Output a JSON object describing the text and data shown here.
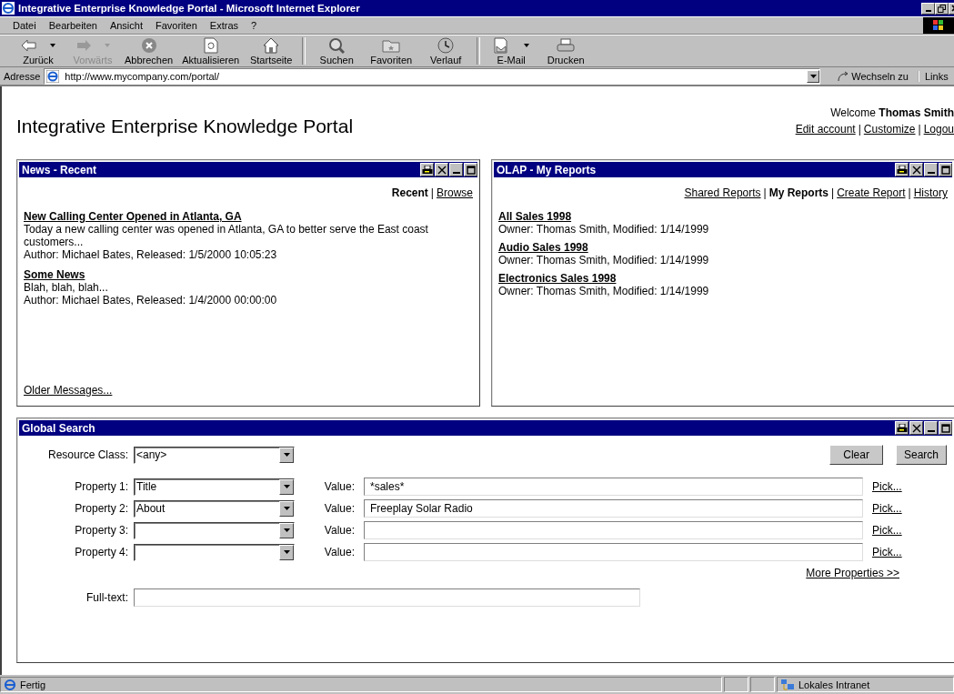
{
  "window": {
    "title": "Integrative Enterprise Knowledge Portal - Microsoft Internet Explorer"
  },
  "menu": [
    "Datei",
    "Bearbeiten",
    "Ansicht",
    "Favoriten",
    "Extras",
    "?"
  ],
  "toolbar": [
    [
      {
        "label": "Zurück",
        "disabled": false,
        "dropdown": true
      },
      {
        "label": "Vorwärts",
        "disabled": true,
        "dropdown": true
      },
      {
        "label": "Abbrechen",
        "disabled": false,
        "dropdown": false
      },
      {
        "label": "Aktualisieren",
        "disabled": false,
        "dropdown": false
      },
      {
        "label": "Startseite",
        "disabled": false,
        "dropdown": false
      }
    ],
    [
      {
        "label": "Suchen",
        "disabled": false,
        "dropdown": false
      },
      {
        "label": "Favoriten",
        "disabled": false,
        "dropdown": false
      },
      {
        "label": "Verlauf",
        "disabled": false,
        "dropdown": false
      }
    ],
    [
      {
        "label": "E-Mail",
        "disabled": false,
        "dropdown": true
      },
      {
        "label": "Drucken",
        "disabled": false,
        "dropdown": false
      }
    ]
  ],
  "address": {
    "label": "Adresse",
    "value": "http://www.mycompany.com/portal/",
    "go": "Wechseln zu",
    "links": "Links"
  },
  "portal": {
    "title": "Integrative Enterprise Knowledge Portal",
    "welcome": "Welcome",
    "user": "Thomas Smith",
    "links": [
      {
        "label": "Edit account"
      },
      {
        "label": "Customize",
        "separator": "|"
      },
      {
        "label": "Logou",
        "separator": "|"
      }
    ]
  },
  "news": {
    "title": "News - Recent",
    "nav": [
      {
        "label": "Recent",
        "selected": true
      },
      {
        "label": "Browse",
        "selected": false,
        "separator": "|"
      }
    ],
    "items": [
      {
        "headline": "New Calling Center Opened in Atlanta, GA",
        "body": "Today a new calling center was opened in Atlanta, GA to better serve the East coast customers...",
        "meta": "Author: Michael Bates, Released: 1/5/2000 10:05:23"
      },
      {
        "headline": "Some News",
        "body": "Blah, blah, blah...",
        "meta": "Author: Michael Bates, Released: 1/4/2000 00:00:00"
      }
    ],
    "footer_link": "Older Messages..."
  },
  "olap": {
    "title": "OLAP - My Reports",
    "nav": [
      {
        "label": "Shared Reports",
        "selected": false
      },
      {
        "label": "My Reports",
        "selected": true,
        "separator": "|"
      },
      {
        "label": "Create Report",
        "selected": false,
        "separator": "|"
      },
      {
        "label": "History",
        "selected": false,
        "separator": "|"
      }
    ],
    "reports": [
      {
        "name": "All Sales 1998",
        "meta": "Owner: Thomas Smith, Modified: 1/14/1999"
      },
      {
        "name": "Audio Sales 1998",
        "meta": "Owner: Thomas Smith, Modified: 1/14/1999"
      },
      {
        "name": "Electronics Sales 1998",
        "meta": "Owner: Thomas Smith, Modified: 1/14/1999"
      }
    ]
  },
  "search": {
    "title": "Global Search",
    "resource_class": {
      "label": "Resource Class:",
      "value": "<any>"
    },
    "buttons": [
      "Clear",
      "Search"
    ],
    "properties": [
      {
        "label": "Property 1:",
        "property": "Title",
        "value_label": "Value:",
        "value": "*sales*",
        "pick": "Pick..."
      },
      {
        "label": "Property 2:",
        "property": "About",
        "value_label": "Value:",
        "value": "Freeplay Solar Radio",
        "pick": "Pick..."
      },
      {
        "label": "Property 3:",
        "value_label": "Value:",
        "pick": "Pick..."
      },
      {
        "label": "Property 4:",
        "value_label": "Value:",
        "pick": "Pick..."
      }
    ],
    "more_link": "More Properties >>",
    "fulltext": {
      "label": "Full-text:"
    }
  },
  "status_bar": {
    "text": "Fertig",
    "zone": "Lokales Intranet"
  }
}
